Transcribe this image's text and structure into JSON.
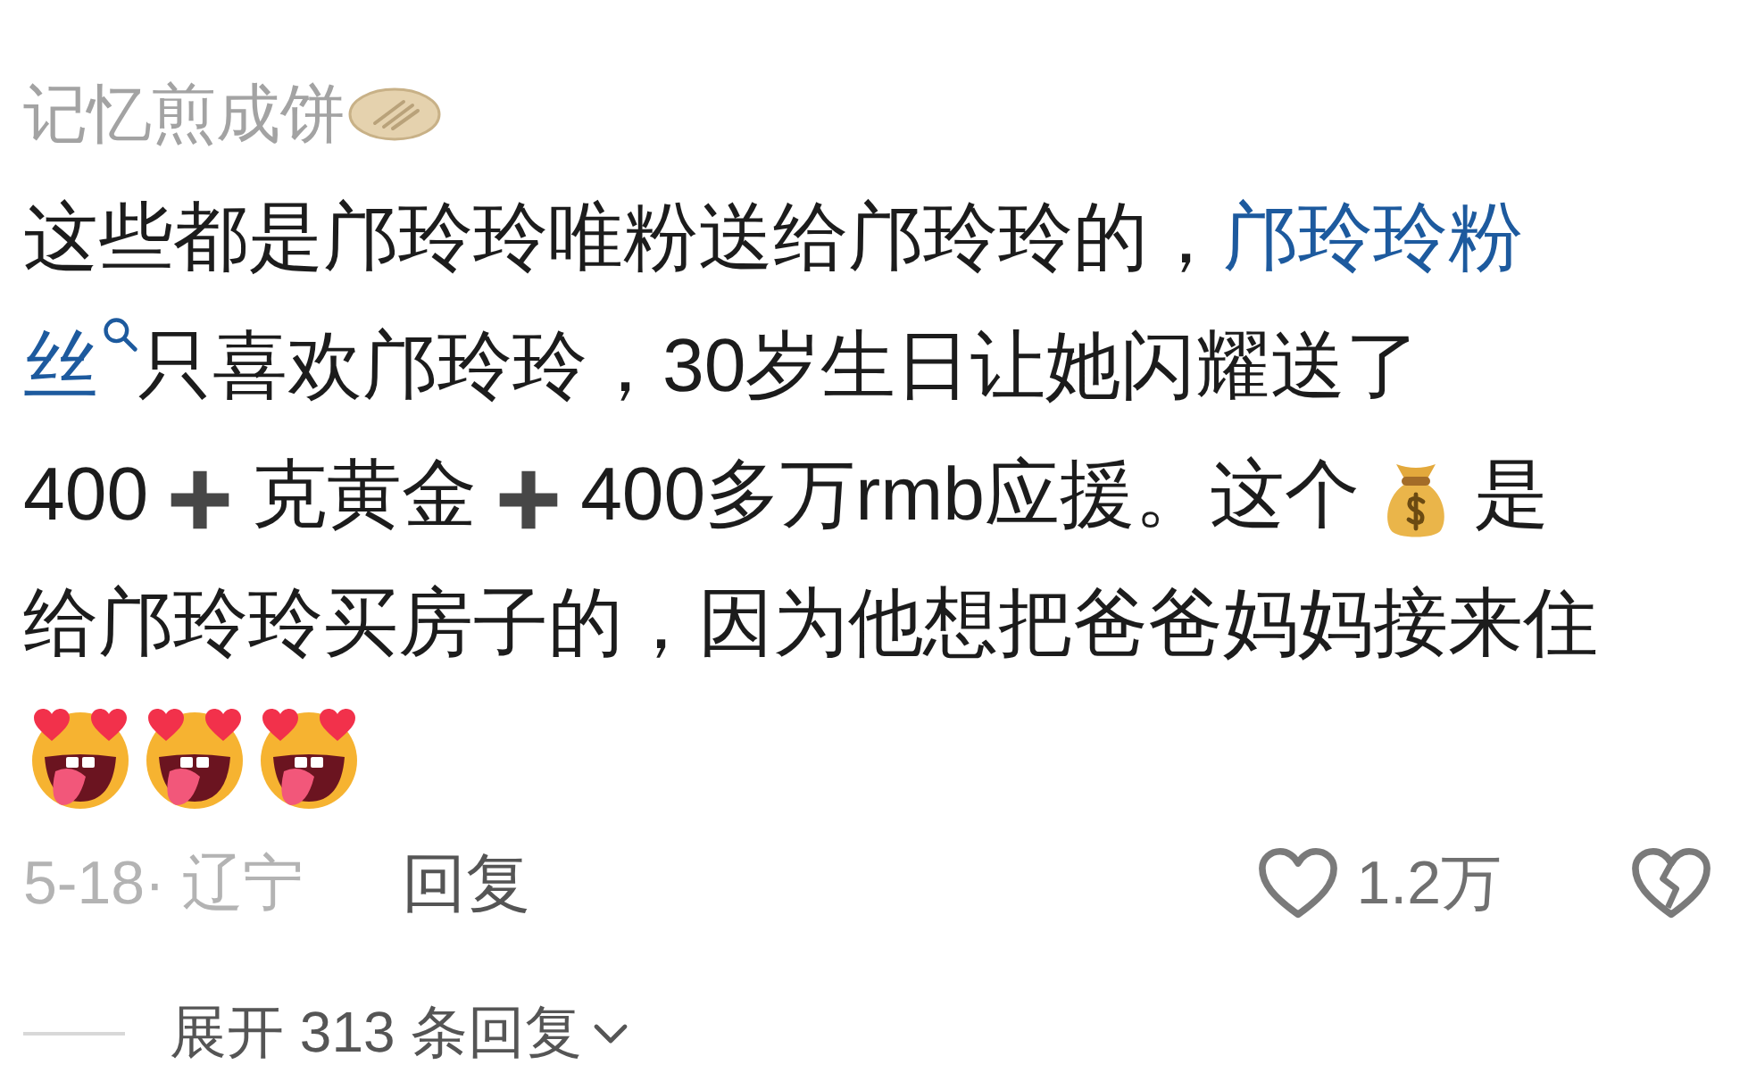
{
  "comment": {
    "author": "记忆煎成饼",
    "lines": [
      [
        {
          "kind": "text",
          "text": "这些都是邝玲玲唯粉送给邝玲玲的，"
        },
        {
          "kind": "link",
          "text": "邝玲玲粉"
        }
      ],
      [
        {
          "kind": "link",
          "text": "丝"
        },
        {
          "kind": "search"
        },
        {
          "kind": "text",
          "text": "只喜欢邝玲玲，30岁生日让她闪耀送了"
        }
      ],
      [
        {
          "kind": "text",
          "text": "400"
        },
        {
          "kind": "plus"
        },
        {
          "kind": "text",
          "text": "克黄金"
        },
        {
          "kind": "plus"
        },
        {
          "kind": "text",
          "text": "400多万rmb应援。这个"
        },
        {
          "kind": "moneybag"
        },
        {
          "kind": "text",
          "text": "是"
        }
      ],
      [
        {
          "kind": "text",
          "text": "给邝玲玲买房子的，因为他想把爸爸妈妈接来住"
        }
      ],
      [
        {
          "kind": "face"
        },
        {
          "kind": "face"
        },
        {
          "kind": "face"
        }
      ]
    ],
    "meta": "5-18· 辽宁",
    "reply_label": "回复",
    "like_count": "1.2万",
    "liked": false,
    "disliked": false,
    "expand_replies": "展开 313 条回复"
  }
}
